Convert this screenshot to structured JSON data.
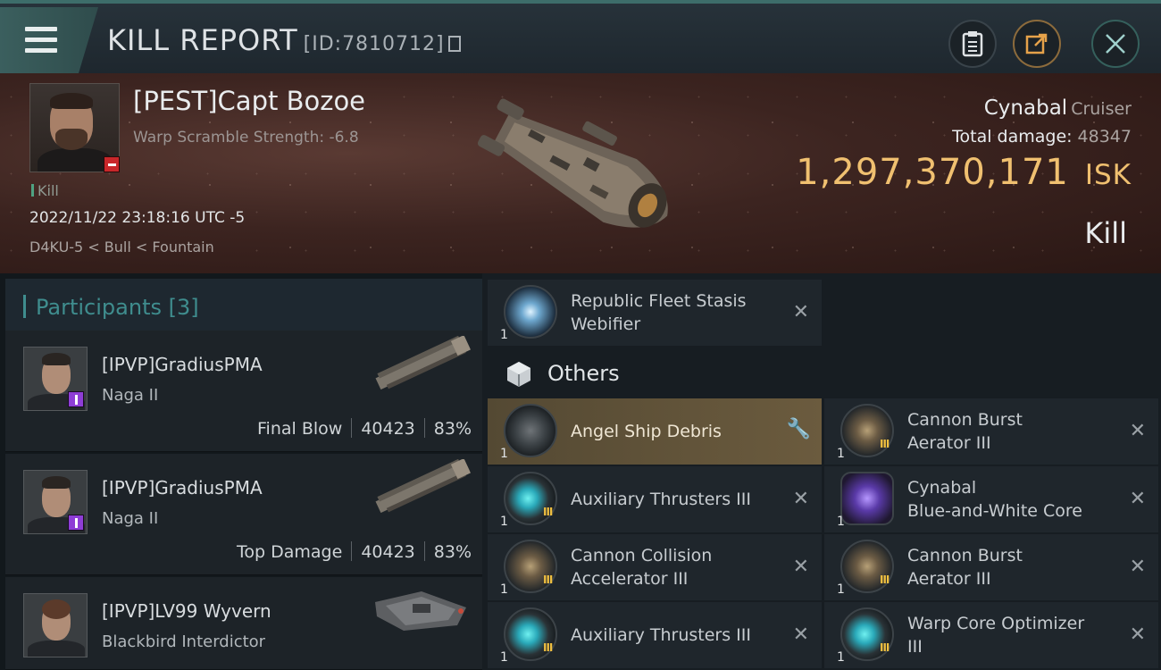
{
  "header": {
    "title": "KILL REPORT",
    "report_id": "[ID:7810712]"
  },
  "victim": {
    "name": "[PEST]Capt Bozoe",
    "scramble": "Warp Scramble Strength: -6.8",
    "kill_tag": "Kill",
    "datetime": "2022/11/22 23:18:16 UTC -5",
    "location": "D4KU-5 < Bull < Fountain",
    "ship": "Cynabal",
    "ship_class": "Cruiser",
    "total_damage_label": "Total damage:",
    "total_damage": "48347",
    "isk_value": "1,297,370,171",
    "isk_unit": "ISK",
    "result": "Kill"
  },
  "participants": {
    "label": "Participants",
    "count": "[3]",
    "rows": [
      {
        "name": "[IPVP]GradiusPMA",
        "ship": "Naga II",
        "role": "Final Blow",
        "damage": "40423",
        "percent": "83%"
      },
      {
        "name": "[IPVP]GradiusPMA",
        "ship": "Naga II",
        "role": "Top Damage",
        "damage": "40423",
        "percent": "83%"
      },
      {
        "name": "[IPVP]LV99 Wyvern",
        "ship": "Blackbird Interdictor"
      }
    ]
  },
  "items": {
    "first": {
      "name": "Republic Fleet Stasis\nWebifier",
      "qty": "1"
    },
    "others_label": "Others",
    "list": [
      {
        "name": "Angel Ship Debris",
        "qty": "1"
      },
      {
        "name": "Cannon Burst\nAerator III",
        "qty": "1"
      },
      {
        "name": "Auxiliary Thrusters III",
        "qty": "1"
      },
      {
        "name": "Cynabal\nBlue-and-White Core",
        "qty": "1"
      },
      {
        "name": "Cannon Collision\nAccelerator III",
        "qty": "1"
      },
      {
        "name": "Cannon Burst\nAerator III",
        "qty": "1"
      },
      {
        "name": "Auxiliary Thrusters III",
        "qty": "1"
      },
      {
        "name": "Warp Core Optimizer\nIII",
        "qty": "1"
      }
    ],
    "tier_badge": "III"
  },
  "colors": {
    "accent_teal": "#3f8d8e",
    "isk_gold": "#f0c070",
    "highlight_gold": "#6b5b3e"
  }
}
